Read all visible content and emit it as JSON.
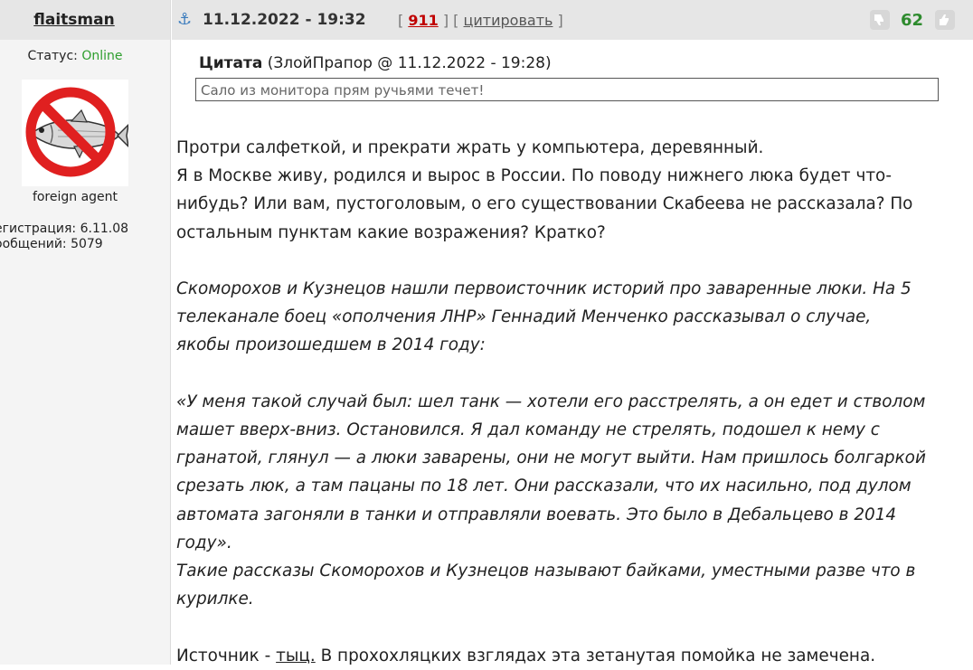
{
  "user": {
    "name": "flaitsman",
    "status_label": "Статус:",
    "status_value": "Online",
    "title": "foreign agent",
    "registration": "егистрация: 6.11.08",
    "messages": "ообщений: 5079"
  },
  "post": {
    "anchor_icon": "anchor-icon",
    "date": "11.12.2022 - 19:32",
    "bracket_open": "[",
    "post_number": "911",
    "bracket_mid": "] [",
    "cite_label": "цитировать",
    "bracket_close": "]",
    "score": "62",
    "vote_down_icon": "thumb-down-icon",
    "vote_up_icon": "thumb-up-icon"
  },
  "quote": {
    "label": "Цитата",
    "source": "(ЗлойПрапор @ 11.12.2022 - 19:28)",
    "text": "Сало из монитора прям ручьями течет!"
  },
  "body": {
    "line1": "Протри салфеткой, и прекрати жрать у компьютера, деревянный.",
    "para2_l1": "Я в Москве живу, родился и вырос в России. По поводу нижнего люка будет что-",
    "para2_l2": "нибудь? Или вам, пустоголовым, о его существовании Скабеева не рассказала? По",
    "para2_l3": "остальным пунктам какие возражения? Кратко?",
    "it1_l1": "Скоморохов и Кузнецов нашли первоисточник историй про заваренные люки. На 5",
    "it1_l2": "телеканале боец «ополчения ЛНР» Геннадий Менченко рассказывал о случае,",
    "it1_l3": "якобы произошедшем в 2014 году:",
    "it2_l1": "«У меня такой случай был: шел танк — хотели его расстрелять, а он едет и стволом",
    "it2_l2": "машет вверх-вниз. Остановился. Я дал команду не стрелять, подошел к нему с",
    "it2_l3": "гранатой, глянул — а люки заварены, они не могут выйти. Нам пришлось болгаркой",
    "it2_l4": "срезать люк, а там пацаны по 18 лет. Они рассказали, что их насильно, под дулом",
    "it2_l5": "автомата загоняли в танки и отправляли воевать. Это было в Дебальцево в 2014",
    "it2_l6": "году».",
    "it3_l1": "Такие рассказы Скоморохов и Кузнецов называют байками, уместными разве что в",
    "it3_l2": "курилке.",
    "source_prefix": "Источник - ",
    "source_link": "тыц.",
    "source_suffix": " В прохохляцких взглядах эта зетанутая помойка не замечена."
  }
}
